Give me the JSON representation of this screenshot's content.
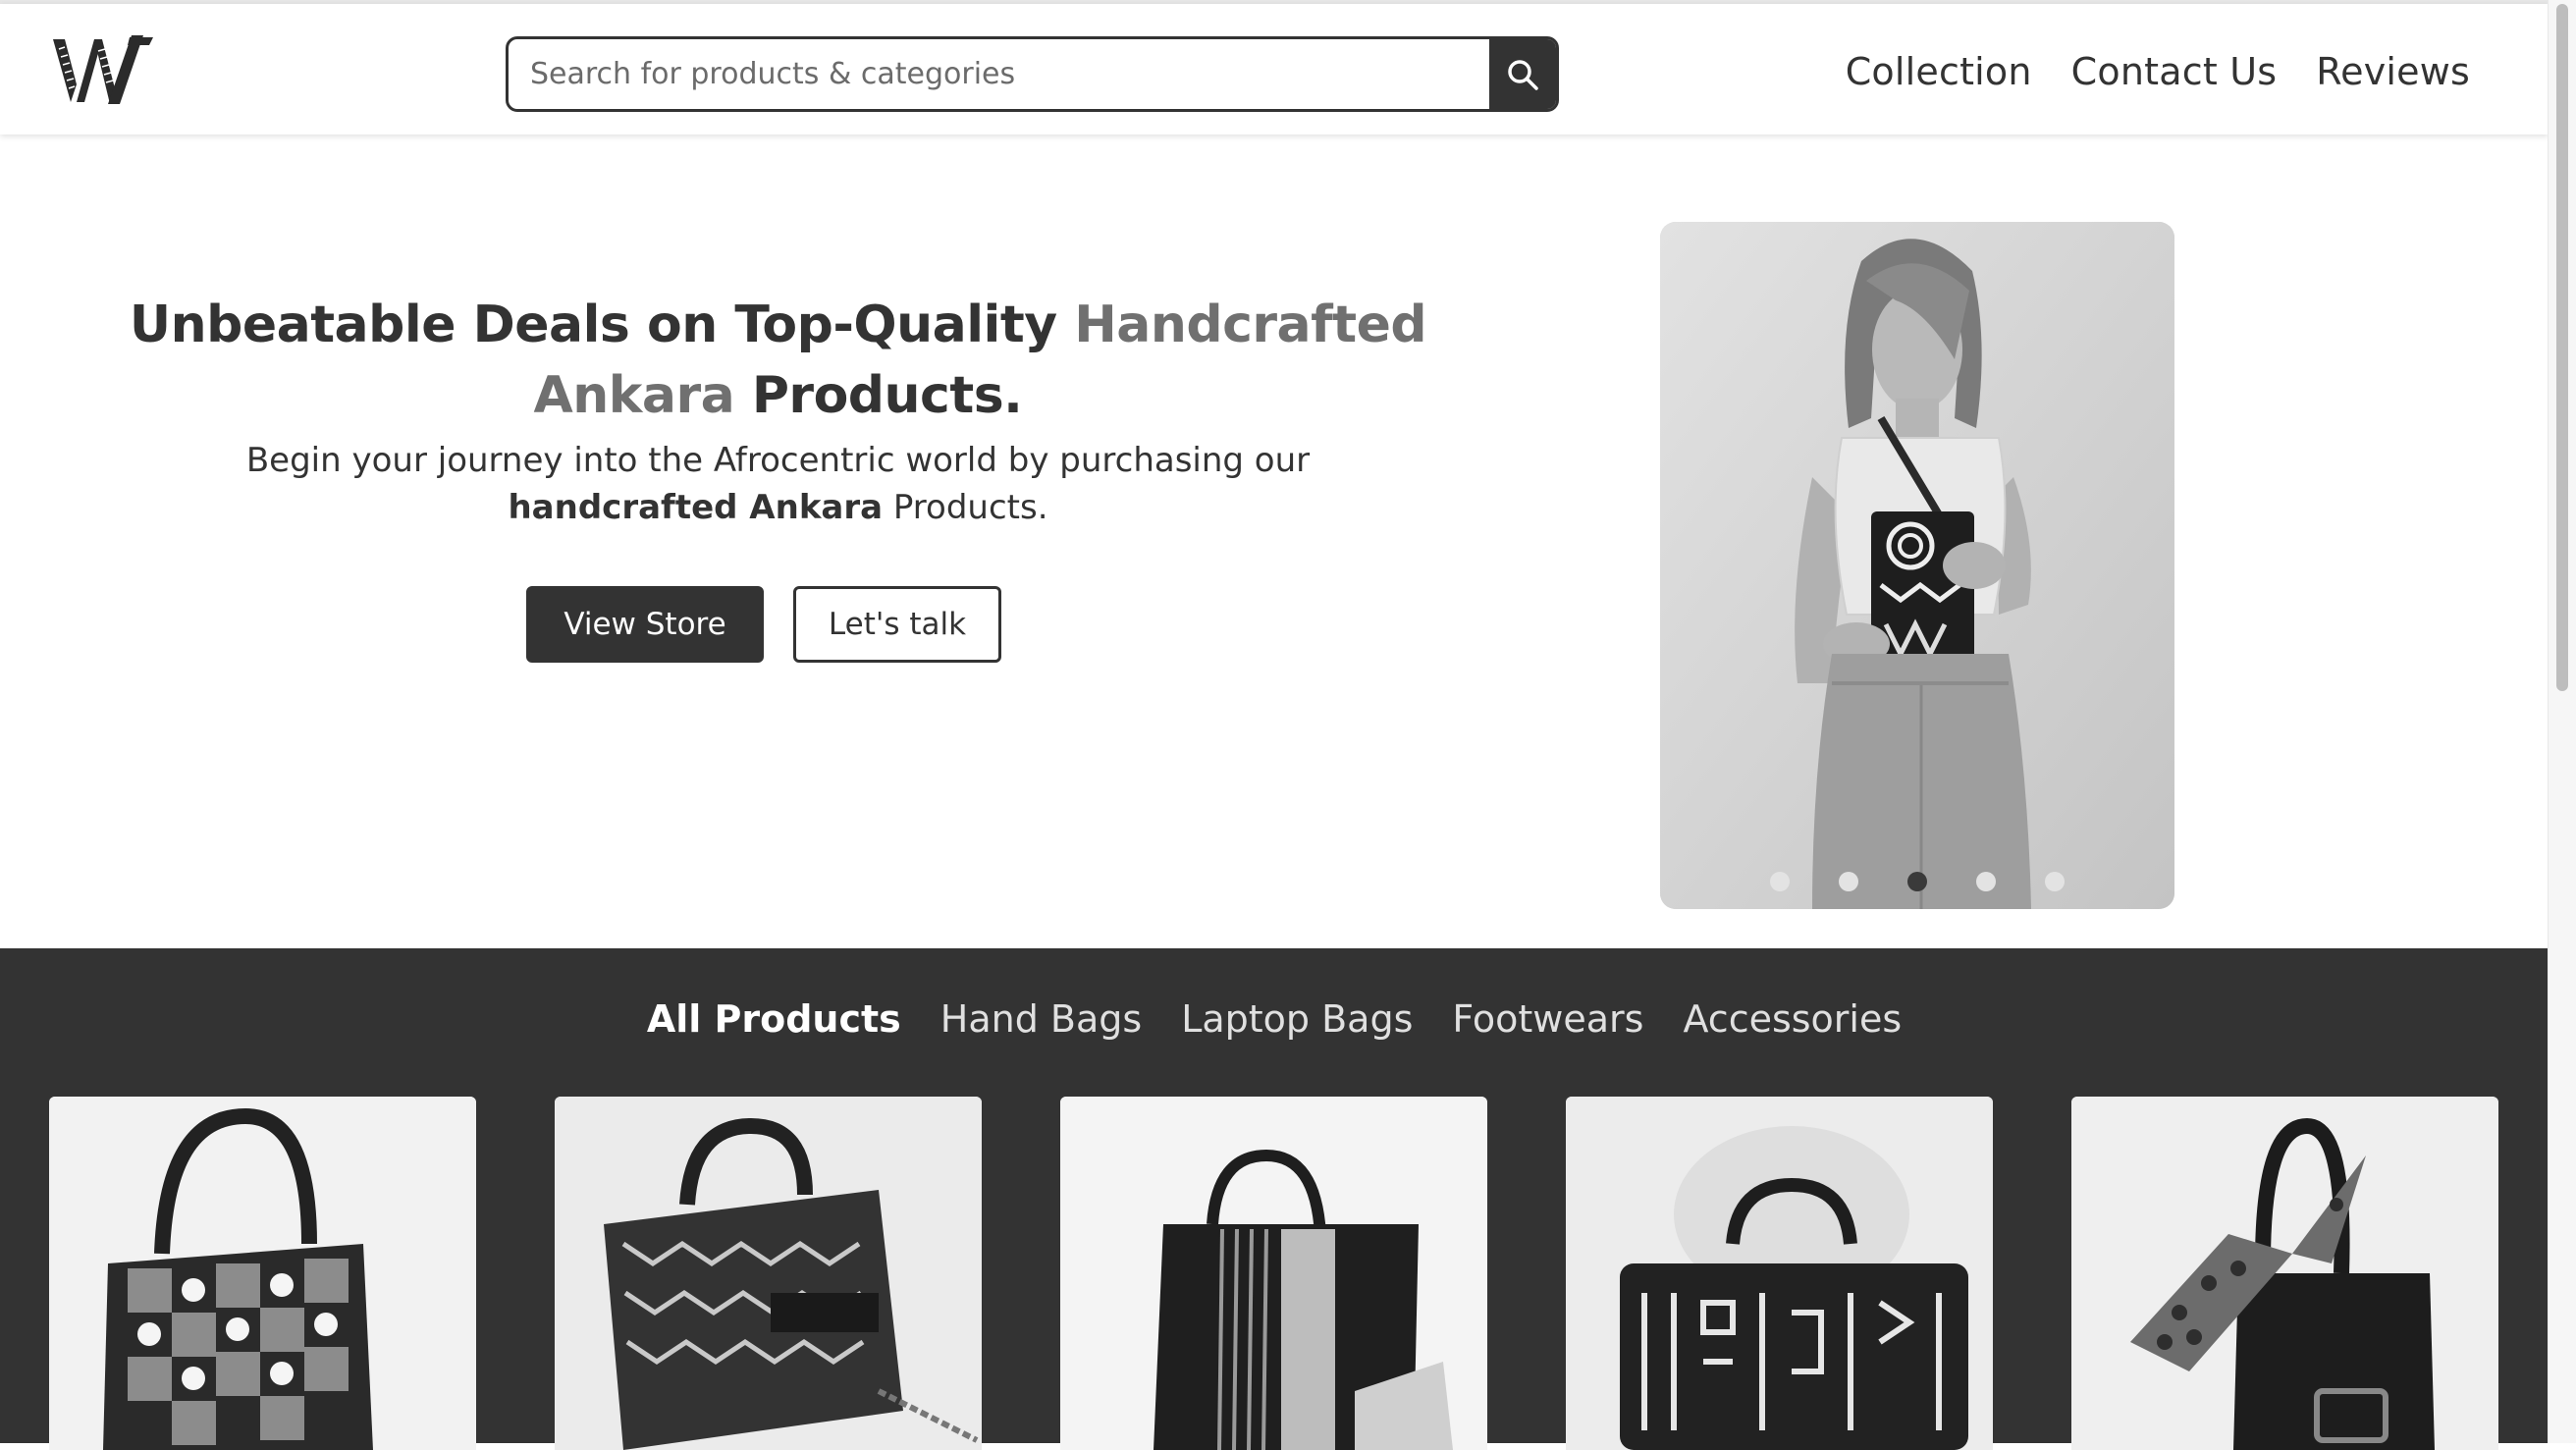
{
  "brand": {
    "logo_icon": "wa-logo-mark"
  },
  "search": {
    "placeholder": "Search for products & categories",
    "icon": "search-icon"
  },
  "nav": {
    "items": [
      "Collection",
      "Contact Us",
      "Reviews"
    ]
  },
  "hero": {
    "title_part1": "Unbeatable Deals on Top-Quality ",
    "title_accent": "Handcrafted Ankara",
    "title_part2": " Products.",
    "sub_part1": "Begin your journey into the Afrocentric world by purchasing our ",
    "sub_bold": "handcrafted Ankara",
    "sub_part2": " Products.",
    "primary_button": "View Store",
    "secondary_button": "Let's talk"
  },
  "carousel": {
    "slide_count": 5,
    "active_index": 2
  },
  "products": {
    "tabs": [
      "All Products",
      "Hand Bags",
      "Laptop Bags",
      "Footwears",
      "Accessories"
    ],
    "active_tab": 0,
    "cards": [
      "patterned-handbag",
      "geometric-clutch",
      "striped-tote",
      "laptop-bag",
      "bow-handbag"
    ]
  },
  "colors": {
    "primary": "#333333",
    "accent": "#707070",
    "background": "#ffffff"
  }
}
